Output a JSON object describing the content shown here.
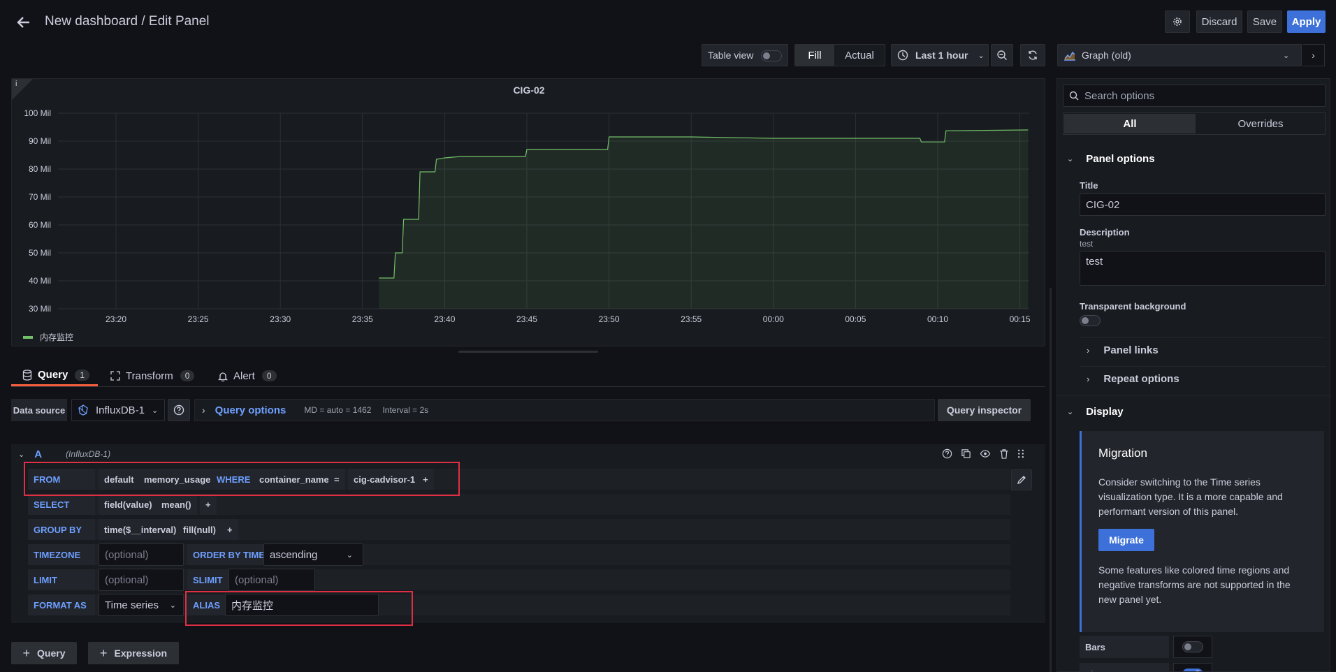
{
  "header": {
    "breadcrumb": "New dashboard / Edit Panel",
    "discard_label": "Discard",
    "save_label": "Save",
    "apply_label": "Apply"
  },
  "toolbar": {
    "table_view_label": "Table view",
    "fill_label": "Fill",
    "actual_label": "Actual",
    "time_range": "Last 1 hour",
    "visualization": "Graph (old)"
  },
  "chart_data": {
    "type": "line",
    "title": "CIG-02",
    "x_ticks": [
      "23:20",
      "23:25",
      "23:30",
      "23:35",
      "23:40",
      "23:45",
      "23:50",
      "23:55",
      "00:00",
      "00:05",
      "00:10",
      "00:15"
    ],
    "y_ticks": [
      "100 Mil",
      "90 Mil",
      "80 Mil",
      "70 Mil",
      "60 Mil",
      "50 Mil",
      "40 Mil",
      "30 Mil"
    ],
    "ylim": [
      30,
      100
    ],
    "series": [
      {
        "name": "内存监控",
        "color": "#73bf69",
        "x": [
          "23:36",
          "23:37",
          "23:37.5",
          "23:38",
          "23:38.5",
          "23:39",
          "23:39.5",
          "23:40",
          "23:41",
          "23:43",
          "23:45",
          "23:47",
          "23:50",
          "23:55",
          "00:00",
          "00:05",
          "00:09",
          "00:10",
          "00:10.5",
          "00:15.5"
        ],
        "values": [
          41,
          50,
          62,
          62,
          79,
          79,
          83.5,
          84,
          84.5,
          84.5,
          87,
          87,
          91.5,
          91.5,
          91,
          91,
          89.7,
          89.7,
          93.7,
          94
        ]
      }
    ],
    "grid": true,
    "legend": "bottom-left"
  },
  "query_tabs": [
    {
      "label": "Query",
      "count": "1"
    },
    {
      "label": "Transform",
      "count": "0"
    },
    {
      "label": "Alert",
      "count": "0"
    }
  ],
  "datasource": {
    "label": "Data source",
    "name": "InfluxDB-1",
    "query_options_label": "Query options",
    "md": "MD = auto = 1462",
    "interval": "Interval = 2s",
    "inspector_label": "Query inspector"
  },
  "query": {
    "ref": "A",
    "ds": "(InfluxDB-1)",
    "from_kw": "FROM",
    "from_policy": "default",
    "from_measurement": "memory_usage",
    "where_kw": "WHERE",
    "where_key": "container_name",
    "where_op": "=",
    "where_value": "cig-cadvisor-1",
    "plus": "+",
    "select_kw": "SELECT",
    "select_field": "field(value)",
    "select_agg": "mean()",
    "groupby_kw": "GROUP BY",
    "groupby_time": "time($__interval)",
    "groupby_fill": "fill(null)",
    "timezone_kw": "TIMEZONE",
    "optional": "(optional)",
    "orderby_kw": "ORDER BY TIME",
    "orderby_value": "ascending",
    "limit_kw": "LIMIT",
    "slimit_kw": "SLIMIT",
    "format_kw": "FORMAT AS",
    "format_value": "Time series",
    "alias_kw": "ALIAS",
    "alias_value": "内存监控"
  },
  "bottom": {
    "add_query": "Query",
    "add_expression": "Expression"
  },
  "options": {
    "search_placeholder": "Search options",
    "tab_all": "All",
    "tab_overrides": "Overrides",
    "panel_options": "Panel options",
    "title_label": "Title",
    "title_value": "CIG-02",
    "description_label": "Description",
    "description_hint": "test",
    "description_value": "test",
    "transparent_label": "Transparent background",
    "panel_links": "Panel links",
    "repeat_options": "Repeat options",
    "display": "Display",
    "migration_title": "Migration",
    "migration_text": "Consider switching to the Time series visualization type. It is a more capable and performant version of this panel.",
    "migrate_btn": "Migrate",
    "migration_note": "Some features like colored time regions and negative transforms are not supported in the new panel yet.",
    "bars_label": "Bars",
    "lines_label": "Lines"
  }
}
